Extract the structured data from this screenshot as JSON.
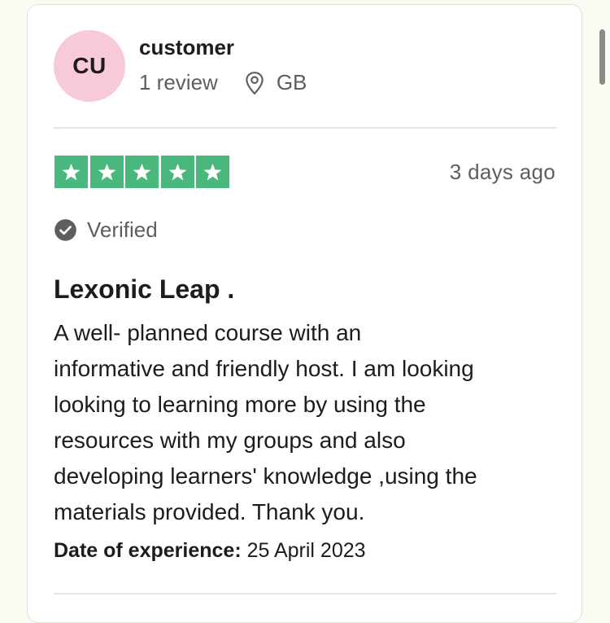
{
  "reviewer": {
    "initials": "CU",
    "name": "customer",
    "review_count": "1 review",
    "location_icon": "map-pin-icon",
    "country": "GB",
    "avatar_color": "#f8c9d6"
  },
  "review": {
    "rating": 5,
    "max_rating": 5,
    "star_color": "#4ab87c",
    "posted": "3 days ago",
    "verified_label": "Verified",
    "title": "Lexonic Leap .",
    "body_lines": [
      "A well- planned course with an",
      "informative and friendly host. I am looking",
      "looking to learning more by using the",
      "resources with my groups and also",
      "developing learners' knowledge ,using the",
      "materials provided. Thank you."
    ],
    "experience_label": "Date of experience:",
    "experience_date": "25 April 2023"
  }
}
